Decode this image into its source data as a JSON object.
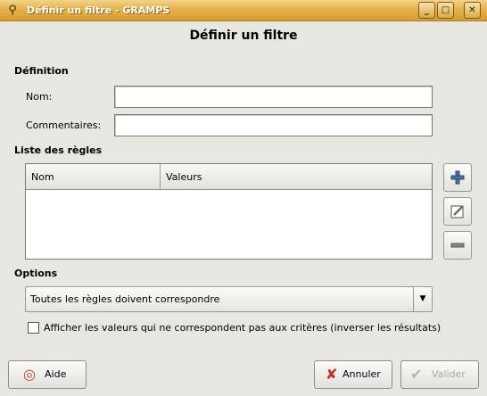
{
  "window": {
    "title": "Définir un filtre - GRAMPS",
    "minimize": "_",
    "maximize": "□",
    "close": "✕"
  },
  "heading": "Définir un filtre",
  "definition": {
    "section": "Définition",
    "name_label": "Nom:",
    "name_value": "",
    "comment_label": "Commentaires:",
    "comment_value": ""
  },
  "rules": {
    "section": "Liste des règles",
    "columns": [
      "Nom",
      "Valeurs"
    ],
    "rows": [],
    "add_icon": "plus-icon",
    "edit_icon": "edit-icon",
    "remove_icon": "minus-icon"
  },
  "options": {
    "section": "Options",
    "combo_value": "Toutes les règles doivent correspondre",
    "invert_checked": false,
    "invert_label": "Afficher les valeurs qui ne correspondent pas aux critères (inverser les résultats)"
  },
  "buttons": {
    "help": "Aide",
    "cancel": "Annuler",
    "ok": "Valider",
    "ok_enabled": false
  }
}
